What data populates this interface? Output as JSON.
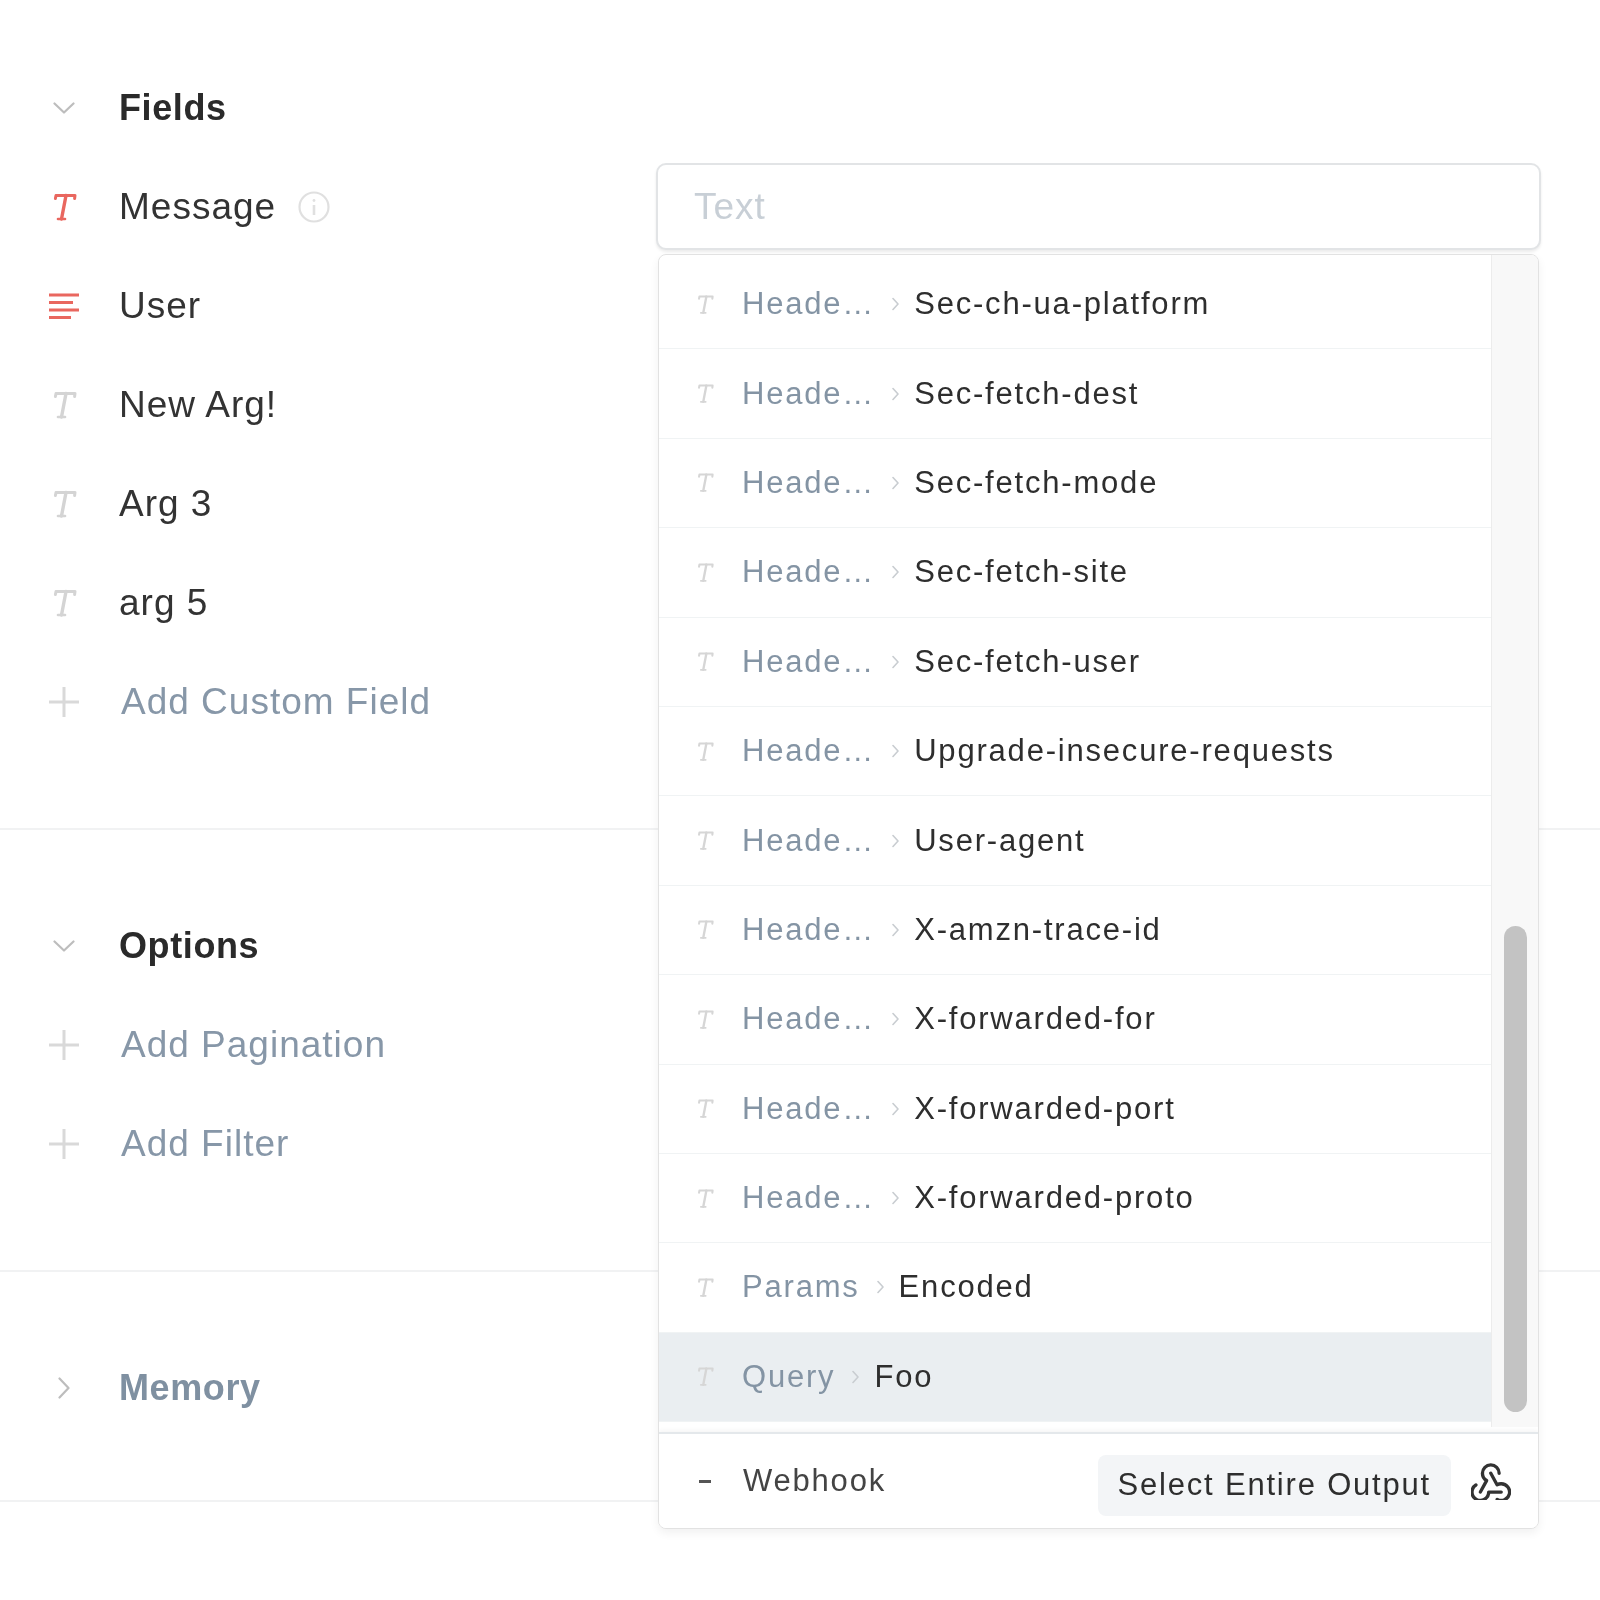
{
  "sections": [
    {
      "title": "Fields",
      "expanded": true,
      "fields": [
        {
          "kind": "text",
          "label": "Message",
          "required": true,
          "info": true,
          "placeholder": "Text"
        },
        {
          "kind": "paragraph",
          "label": "User",
          "required": true,
          "info": false
        },
        {
          "kind": "text",
          "label": "New Arg!",
          "required": false,
          "info": false
        },
        {
          "kind": "text",
          "label": "Arg 3",
          "required": false,
          "info": false
        },
        {
          "kind": "text",
          "label": "arg 5",
          "required": false,
          "info": false
        }
      ],
      "actions": [
        "Add Custom Field"
      ]
    },
    {
      "title": "Options",
      "expanded": true,
      "actions": [
        "Add Pagination",
        "Add Filter"
      ]
    },
    {
      "title": "Memory",
      "expanded": false
    }
  ],
  "dropdown": {
    "options": [
      {
        "path": "Heade…",
        "name": "Sec-ch-ua-platform",
        "selected": false
      },
      {
        "path": "Heade…",
        "name": "Sec-fetch-dest",
        "selected": false
      },
      {
        "path": "Heade…",
        "name": "Sec-fetch-mode",
        "selected": false
      },
      {
        "path": "Heade…",
        "name": "Sec-fetch-site",
        "selected": false
      },
      {
        "path": "Heade…",
        "name": "Sec-fetch-user",
        "selected": false
      },
      {
        "path": "Heade…",
        "name": "Upgrade-insecure-requests",
        "selected": false
      },
      {
        "path": "Heade…",
        "name": "User-agent",
        "selected": false
      },
      {
        "path": "Heade…",
        "name": "X-amzn-trace-id",
        "selected": false
      },
      {
        "path": "Heade…",
        "name": "X-forwarded-for",
        "selected": false
      },
      {
        "path": "Heade…",
        "name": "X-forwarded-port",
        "selected": false
      },
      {
        "path": "Heade…",
        "name": "X-forwarded-proto",
        "selected": false
      },
      {
        "path": "Params",
        "name": "Encoded",
        "selected": false
      },
      {
        "path": "Query",
        "name": "Foo",
        "selected": true
      }
    ],
    "footer": {
      "source": "Webhook",
      "button": "Select Entire Output"
    }
  }
}
